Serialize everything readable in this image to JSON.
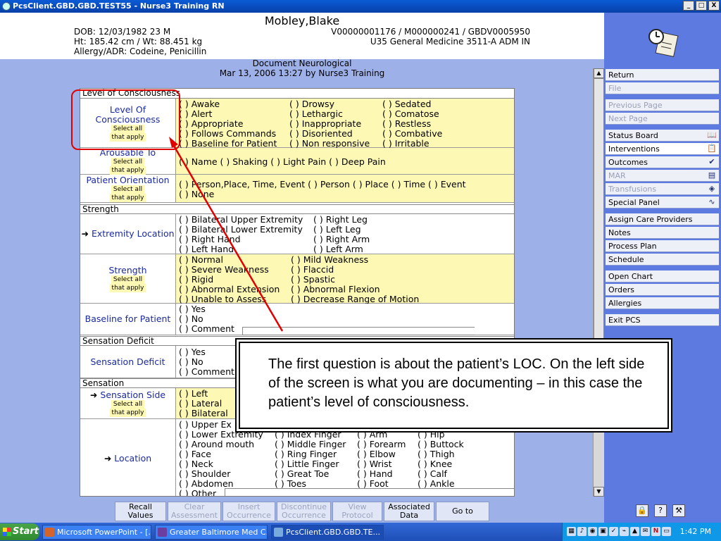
{
  "window": {
    "title": "PcsClient.GBD.GBD.TEST55 - Nurse3 Training RN",
    "buttons": [
      "_",
      "□",
      "X"
    ]
  },
  "patient": {
    "name": "Mobley,Blake",
    "dob": "DOB: 12/03/1982  23 M",
    "htwt": "Ht: 185.42 cm / Wt: 88.451 kg",
    "allergy": "Allergy/ADR: Codeine, Penicillin",
    "ids": "V00000001176 / M000000241 / GBDV0005950",
    "location": "U35 General Medicine  3511-A  ADM IN"
  },
  "document": {
    "title": "Document Neurological",
    "line2": "Mar 13, 2006 13:27  by  Nurse3 Training"
  },
  "select_all": [
    "Select all",
    "that apply"
  ],
  "form": {
    "sec_loc": "Level of Consciousness",
    "loc_label": [
      "Level Of",
      "Consciousness"
    ],
    "loc_opts": [
      [
        "( )  Awake",
        "( )  Drowsy",
        "( )  Sedated"
      ],
      [
        "( )  Alert",
        "( )  Lethargic",
        "( )  Comatose"
      ],
      [
        "( )  Appropriate",
        "( )  Inappropriate",
        "( )  Restless"
      ],
      [
        "( )  Follows Commands",
        "( )  Disoriented",
        "( )  Combative"
      ],
      [
        "( )  Baseline for Patient",
        "( )  Non responsive",
        "( )  Irritable"
      ]
    ],
    "arousable_label": "Arousable To",
    "arousable_opts": "( )  Name  ( )  Shaking  ( )  Light Pain  ( )  Deep Pain",
    "orient_label": "Patient Orientation",
    "orient_opts": [
      "( )  Person,Place, Time, Event  ( )  Person  ( )  Place  ( )  Time  ( )  Event",
      "( )  None"
    ],
    "sec_strength": "Strength",
    "extremity_label": "Extremity Location",
    "extremity_opts": [
      [
        "( )  Bilateral Upper Extremity",
        "( )  Right Leg"
      ],
      [
        "( )  Bilateral Lower Extremity",
        "( )  Left Leg"
      ],
      [
        "( )  Right Hand",
        "( )  Right Arm"
      ],
      [
        "( )  Left Hand",
        "( )  Left Arm"
      ]
    ],
    "strength_label": "Strength",
    "strength_opts": [
      [
        "( )  Normal",
        "( )  Mild Weakness"
      ],
      [
        "( )  Severe Weakness",
        "( )  Flaccid"
      ],
      [
        "( )  Rigid",
        "( )  Spastic"
      ],
      [
        "( )  Abnormal Extension",
        "( )  Abnormal Flexion"
      ],
      [
        "( )  Unable to Assess",
        "( )  Decrease Range of Motion"
      ]
    ],
    "baseline_label": "Baseline for Patient",
    "baseline_opts": [
      "( )  Yes",
      "( )  No",
      "( )  Comment"
    ],
    "sec_sens_def": "Sensation Deficit",
    "sens_def_label": "Sensation Deficit",
    "sens_def_opts": [
      "( )  Yes",
      "( )  No",
      "( )  Comment"
    ],
    "sec_sensation": "Sensation",
    "sens_side_label": "Sensation Side",
    "sens_side_opts": [
      "( )  Left",
      "( )  Lateral",
      "( )  Bilateral"
    ],
    "location_label": "Location",
    "location_opts": [
      [
        "( )  Upper Ex",
        "",
        "",
        ""
      ],
      [
        "( )  Lower Extremity",
        "( )  Index Finger",
        "( )  Arm",
        "( )  Hip"
      ],
      [
        "( )  Around mouth",
        "( )  Middle Finger",
        "( )  Forearm",
        "( )  Buttock"
      ],
      [
        "( )  Face",
        "( )  Ring Finger",
        "( )  Elbow",
        "( )  Thigh"
      ],
      [
        "( )  Neck",
        "( )  Little Finger",
        "( )  Wrist",
        "( )  Knee"
      ],
      [
        "( )  Shoulder",
        "( )  Great Toe",
        "( )  Hand",
        "( )  Calf"
      ],
      [
        "( )  Abdomen",
        "( )  Toes",
        "( )  Foot",
        "( )  Ankle"
      ],
      [
        "( )  Other",
        "",
        "",
        ""
      ]
    ]
  },
  "callout": "The first question is about the patient’s LOC. On the left side of the screen is what you are documenting – in this case the patient’s level of consciousness.",
  "sidebar": {
    "group1": [
      {
        "label": "Return",
        "state": "enabled"
      },
      {
        "label": "File",
        "state": "disabled"
      }
    ],
    "group2": [
      {
        "label": "Previous Page",
        "state": "disabled"
      },
      {
        "label": "Next Page",
        "state": "disabled"
      }
    ],
    "group3": [
      {
        "label": "Status Board",
        "state": "enabled",
        "icon": "book-icon"
      },
      {
        "label": "Interventions",
        "state": "selected",
        "icon": "clipboard-icon"
      },
      {
        "label": "Outcomes",
        "state": "enabled",
        "icon": "checklist-icon"
      },
      {
        "label": "MAR",
        "state": "disabled",
        "icon": "mar-icon"
      },
      {
        "label": "Transfusions",
        "state": "disabled",
        "icon": "blood-bag-icon"
      },
      {
        "label": "Special Panel",
        "state": "enabled",
        "icon": "waveform-icon"
      }
    ],
    "group4": [
      {
        "label": "Assign Care Providers"
      },
      {
        "label": "Notes"
      },
      {
        "label": "Process Plan"
      },
      {
        "label": "Schedule"
      }
    ],
    "group5": [
      {
        "label": "Open Chart"
      },
      {
        "label": "Orders"
      },
      {
        "label": "Allergies"
      }
    ],
    "group6": [
      {
        "label": "Exit PCS"
      }
    ]
  },
  "bottom_buttons": [
    {
      "label": "Recall\nValues",
      "state": "enabled"
    },
    {
      "label": "Clear\nAssessment",
      "state": "disabled"
    },
    {
      "label": "Insert\nOccurrence",
      "state": "disabled"
    },
    {
      "label": "Discontinue\nOccurrence",
      "state": "disabled"
    },
    {
      "label": "View\nProtocol",
      "state": "disabled"
    },
    {
      "label": "Associated\nData",
      "state": "enabled"
    },
    {
      "label": "Go to",
      "state": "enabled"
    }
  ],
  "taskbar": {
    "start": "Start",
    "items": [
      "Microsoft PowerPoint - [...",
      "Greater Baltimore Med C...",
      "PcsClient.GBD.GBD.TE..."
    ],
    "time": "1:42 PM"
  },
  "colors": {
    "highlight_ring": "#e00000",
    "form_yellow": "#fdf8b4",
    "label_blue": "#1a2aa0",
    "sidebar_blue": "#5d7ae0"
  }
}
